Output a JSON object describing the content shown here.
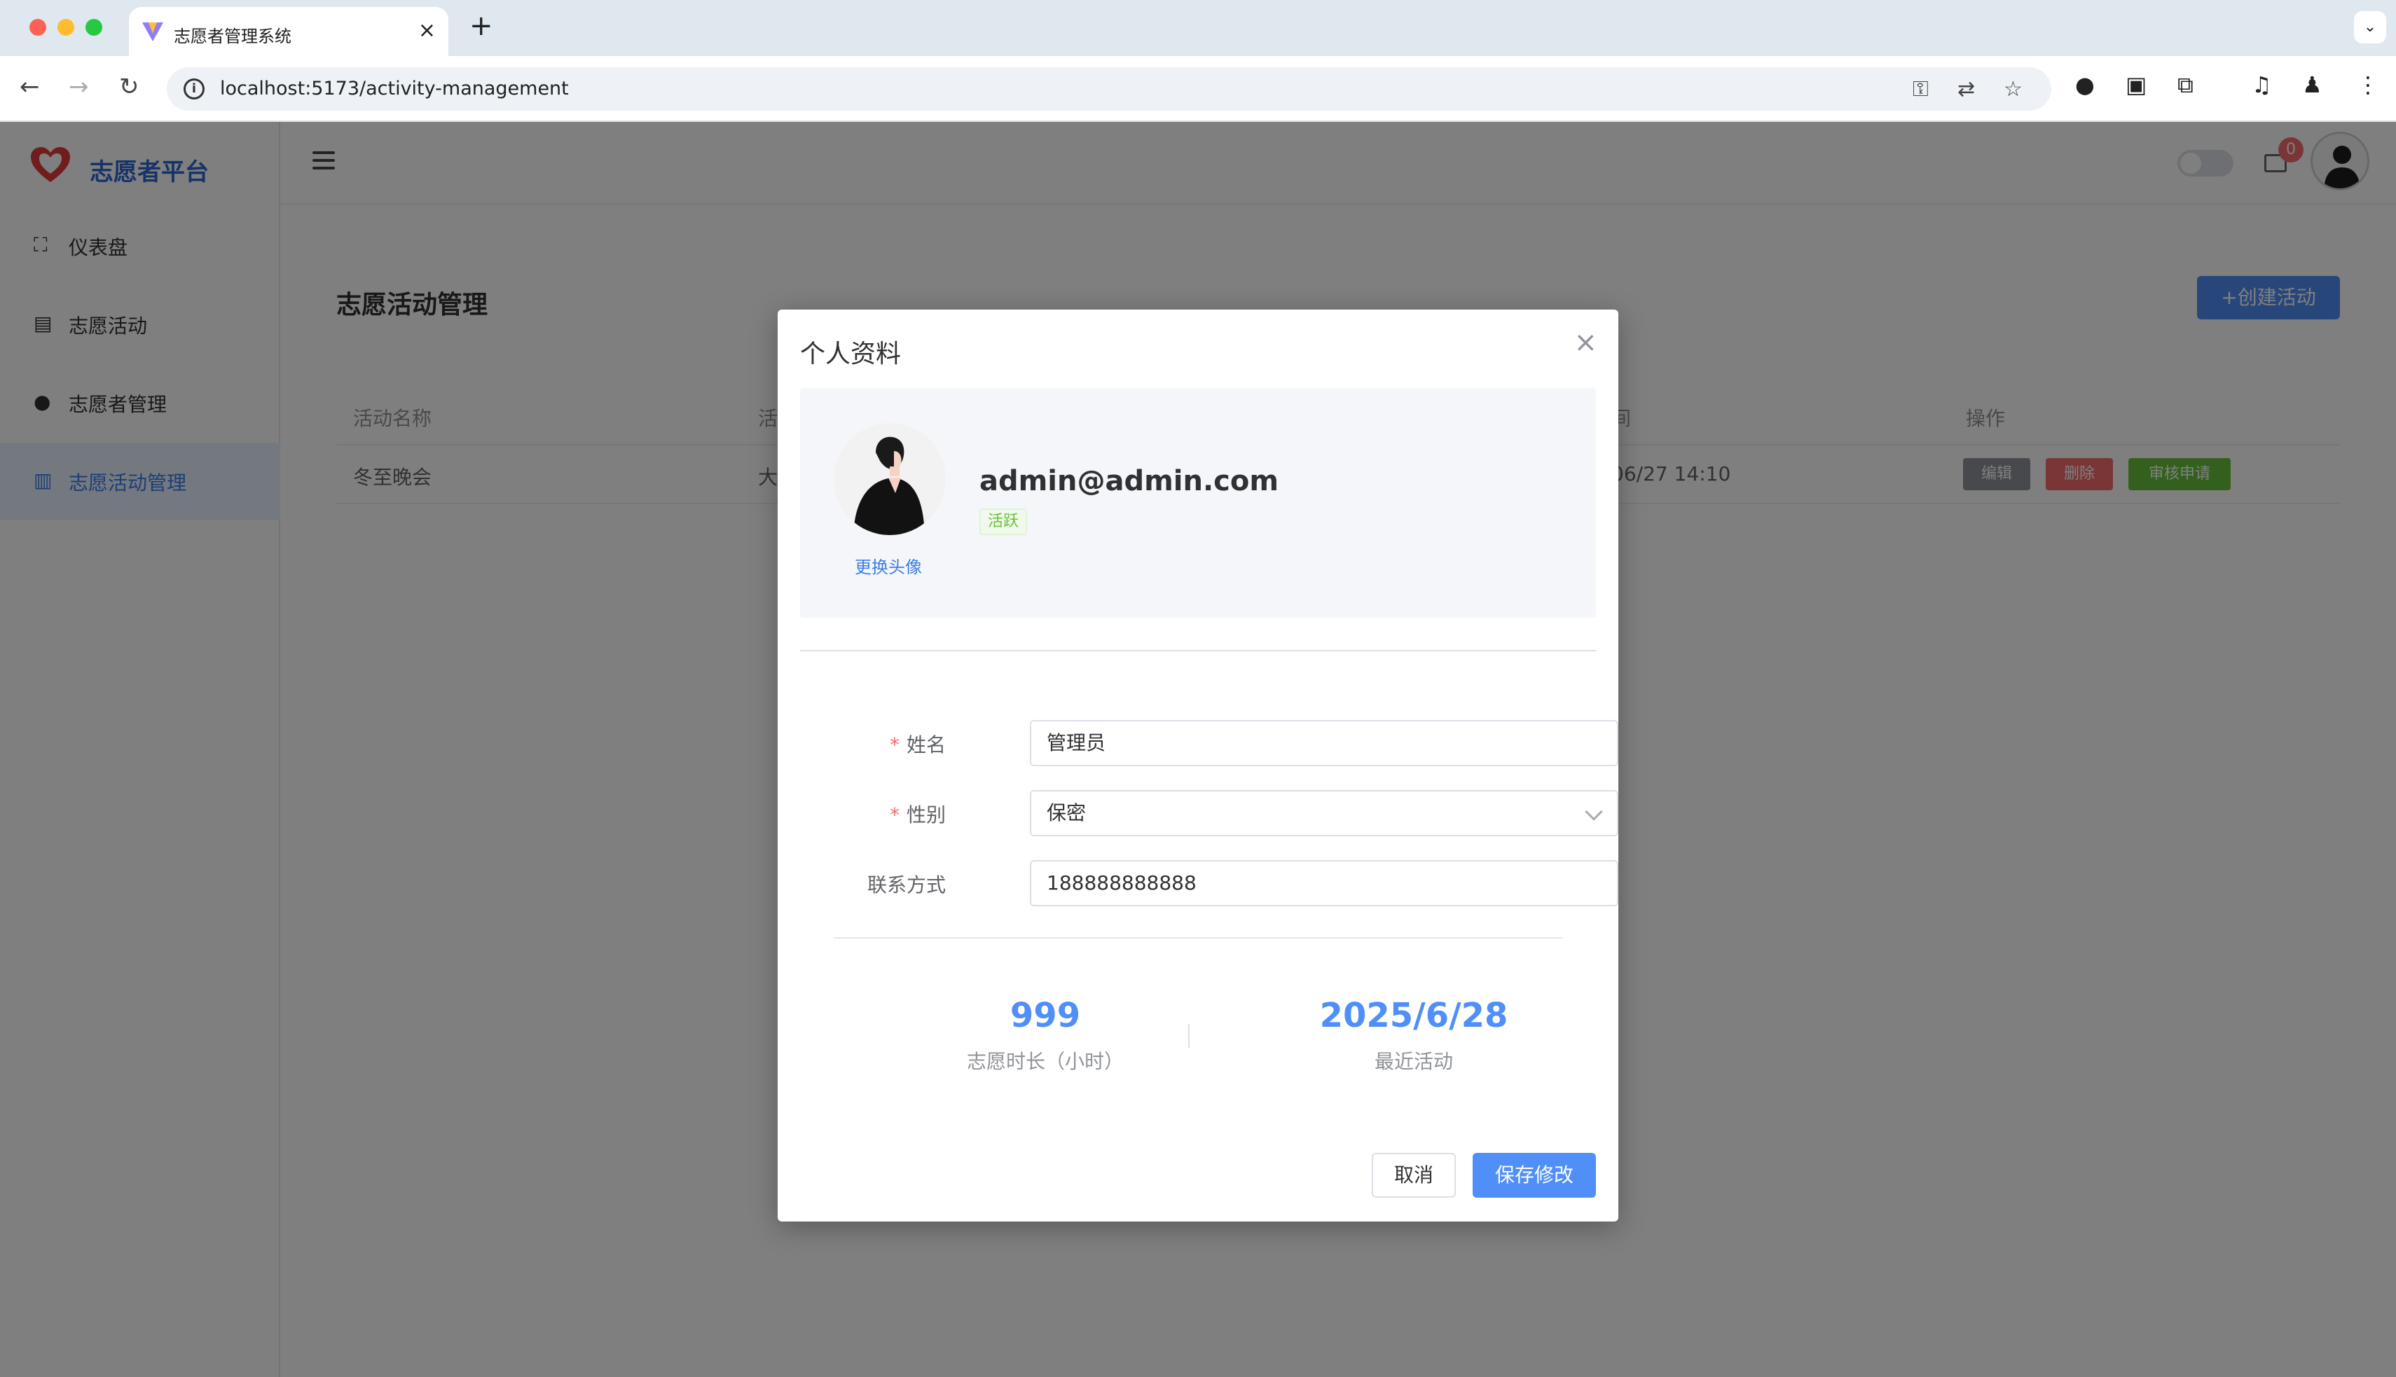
{
  "browser": {
    "tab_title": "志愿者管理系统",
    "url": "localhost:5173/activity-management"
  },
  "sidebar": {
    "brand": "志愿者平台",
    "items": [
      {
        "label": "仪表盘",
        "icon": "presentation-icon"
      },
      {
        "label": "志愿活动",
        "icon": "clipboard-icon"
      },
      {
        "label": "志愿者管理",
        "icon": "user-icon"
      },
      {
        "label": "志愿活动管理",
        "icon": "chart-icon",
        "active": true
      }
    ]
  },
  "header": {
    "notification_count": "0"
  },
  "page": {
    "title": "志愿活动管理",
    "create_button": "+创建活动",
    "table": {
      "headers": [
        "活动名称",
        "活",
        "间",
        "操作"
      ],
      "rows": [
        {
          "name": "冬至晚会",
          "col2": "大",
          "time": "06/27 14:10"
        }
      ],
      "actions": {
        "edit": "编辑",
        "delete": "删除",
        "review": "审核申请"
      }
    }
  },
  "dialog": {
    "title": "个人资料",
    "change_avatar": "更换头像",
    "email": "admin@admin.com",
    "status": "活跃",
    "form": {
      "name_label": "姓名",
      "name_value": "管理员",
      "gender_label": "性别",
      "gender_value": "保密",
      "contact_label": "联系方式",
      "contact_value": "188888888888"
    },
    "stats": {
      "hours_value": "999",
      "hours_label": "志愿时长（小时）",
      "recent_value": "2025/6/28",
      "recent_label": "最近活动"
    },
    "cancel": "取消",
    "save": "保存修改"
  },
  "colors": {
    "primary": "#4f8ff7",
    "danger": "#f56c6c",
    "success": "#67c23a",
    "info": "#909399"
  }
}
